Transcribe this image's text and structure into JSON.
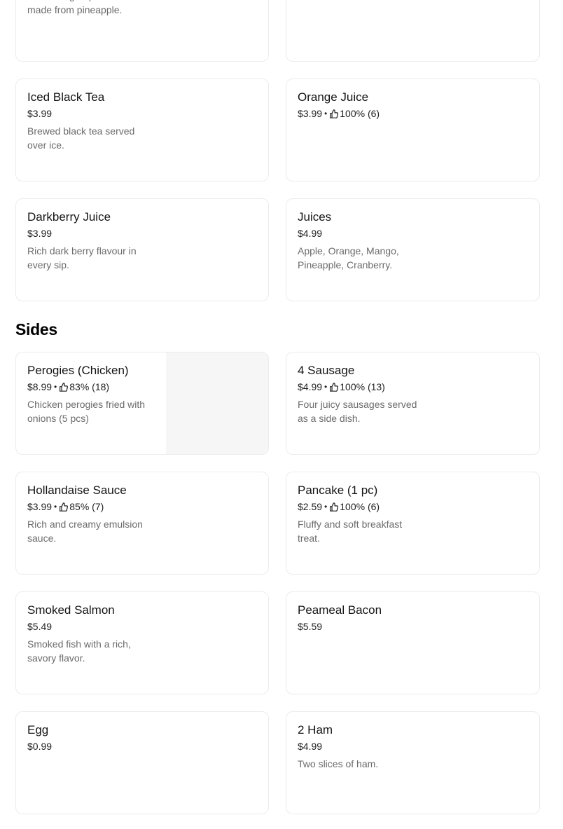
{
  "drinks": {
    "items": [
      {
        "name": "",
        "price": "",
        "rating": "",
        "description": "Refreshing tropical drink made from pineapple."
      },
      {
        "name": "",
        "price": "",
        "rating": "",
        "description": ""
      },
      {
        "name": "Iced Black Tea",
        "price": "$3.99",
        "rating": "",
        "description": "Brewed black tea served over ice."
      },
      {
        "name": "Orange Juice",
        "price": "$3.99",
        "rating": "100% (6)",
        "description": ""
      },
      {
        "name": "Darkberry Juice",
        "price": "$3.99",
        "rating": "",
        "description": "Rich dark berry flavour in every sip."
      },
      {
        "name": "Juices",
        "price": "$4.99",
        "rating": "",
        "description": "Apple, Orange, Mango, Pineapple, Cranberry."
      }
    ]
  },
  "sides": {
    "title": "Sides",
    "items": [
      {
        "name": "Perogies (Chicken)",
        "price": "$8.99",
        "rating": "83% (18)",
        "description": "Chicken perogies fried with onions (5 pcs)",
        "has_image": true
      },
      {
        "name": "4 Sausage",
        "price": "$4.99",
        "rating": "100% (13)",
        "description": "Four juicy sausages served as a side dish."
      },
      {
        "name": "Hollandaise Sauce",
        "price": "$3.99",
        "rating": "85% (7)",
        "description": "Rich and creamy emulsion sauce."
      },
      {
        "name": "Pancake (1 pc)",
        "price": "$2.59",
        "rating": "100% (6)",
        "description": "Fluffy and soft breakfast treat."
      },
      {
        "name": "Smoked Salmon",
        "price": "$5.49",
        "rating": "",
        "description": "Smoked fish with a rich, savory flavor."
      },
      {
        "name": "Peameal Bacon",
        "price": "$5.59",
        "rating": "",
        "description": ""
      },
      {
        "name": "Egg",
        "price": "$0.99",
        "rating": "",
        "description": ""
      },
      {
        "name": "2 Ham",
        "price": "$4.99",
        "rating": "",
        "description": "Two slices of ham."
      }
    ]
  },
  "separator": "•",
  "icons": {
    "rating": "thumbs-up-icon"
  },
  "colors": {
    "card_border": "#ececec",
    "description_text": "#6b6b6b",
    "image_placeholder": "#f6f6f6"
  }
}
